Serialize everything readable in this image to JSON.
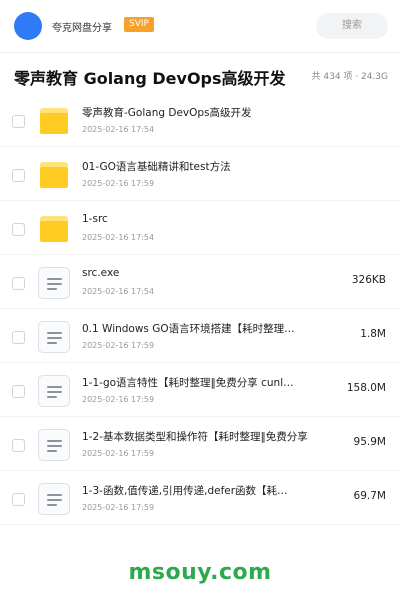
{
  "header": {
    "app_name": "夸克网盘分享",
    "badge": "SVIP",
    "search_label": "搜索",
    "colors": {
      "avatar": "#2f7bf5",
      "badge": "#f7a12b"
    }
  },
  "folder": {
    "title": "零声教育 Golang DevOps高级开发",
    "meta": "共 434 项 · 24.3G"
  },
  "items": [
    {
      "type": "folder",
      "icon": "folder-icon",
      "name": "零声教育-Golang DevOps高级开发",
      "date": "2025-02-16 17:54",
      "size": ""
    },
    {
      "type": "folder",
      "icon": "folder-icon",
      "name": "01-GO语言基础精讲和test方法",
      "date": "2025-02-16 17:59",
      "size": ""
    },
    {
      "type": "folder",
      "icon": "folder-icon",
      "name": "1-src",
      "date": "2025-02-16 17:54",
      "size": ""
    },
    {
      "type": "file",
      "icon": "file-icon",
      "name": "src.exe",
      "date": "2025-02-16 17:54",
      "size": "326KB"
    },
    {
      "type": "file",
      "icon": "file-icon",
      "name": "0.1 Windows GO语言环境搭建【耗时整理…",
      "date": "2025-02-16 17:59",
      "size": "1.8M"
    },
    {
      "type": "file",
      "icon": "file-icon",
      "name": "1-1-go语言特性【耗时整理‖免费分享 cunl…",
      "date": "2025-02-16 17:59",
      "size": "158.0M"
    },
    {
      "type": "file",
      "icon": "file-icon",
      "name": "1-2-基本数据类型和操作符【耗时整理‖免费分享",
      "date": "2025-02-16 17:59",
      "size": "95.9M"
    },
    {
      "type": "file",
      "icon": "file-icon",
      "name": "1-3-函数,值传递,引用传递,defer函数【耗…",
      "date": "2025-02-16 17:59",
      "size": "69.7M"
    }
  ],
  "watermark": "msouy.com"
}
